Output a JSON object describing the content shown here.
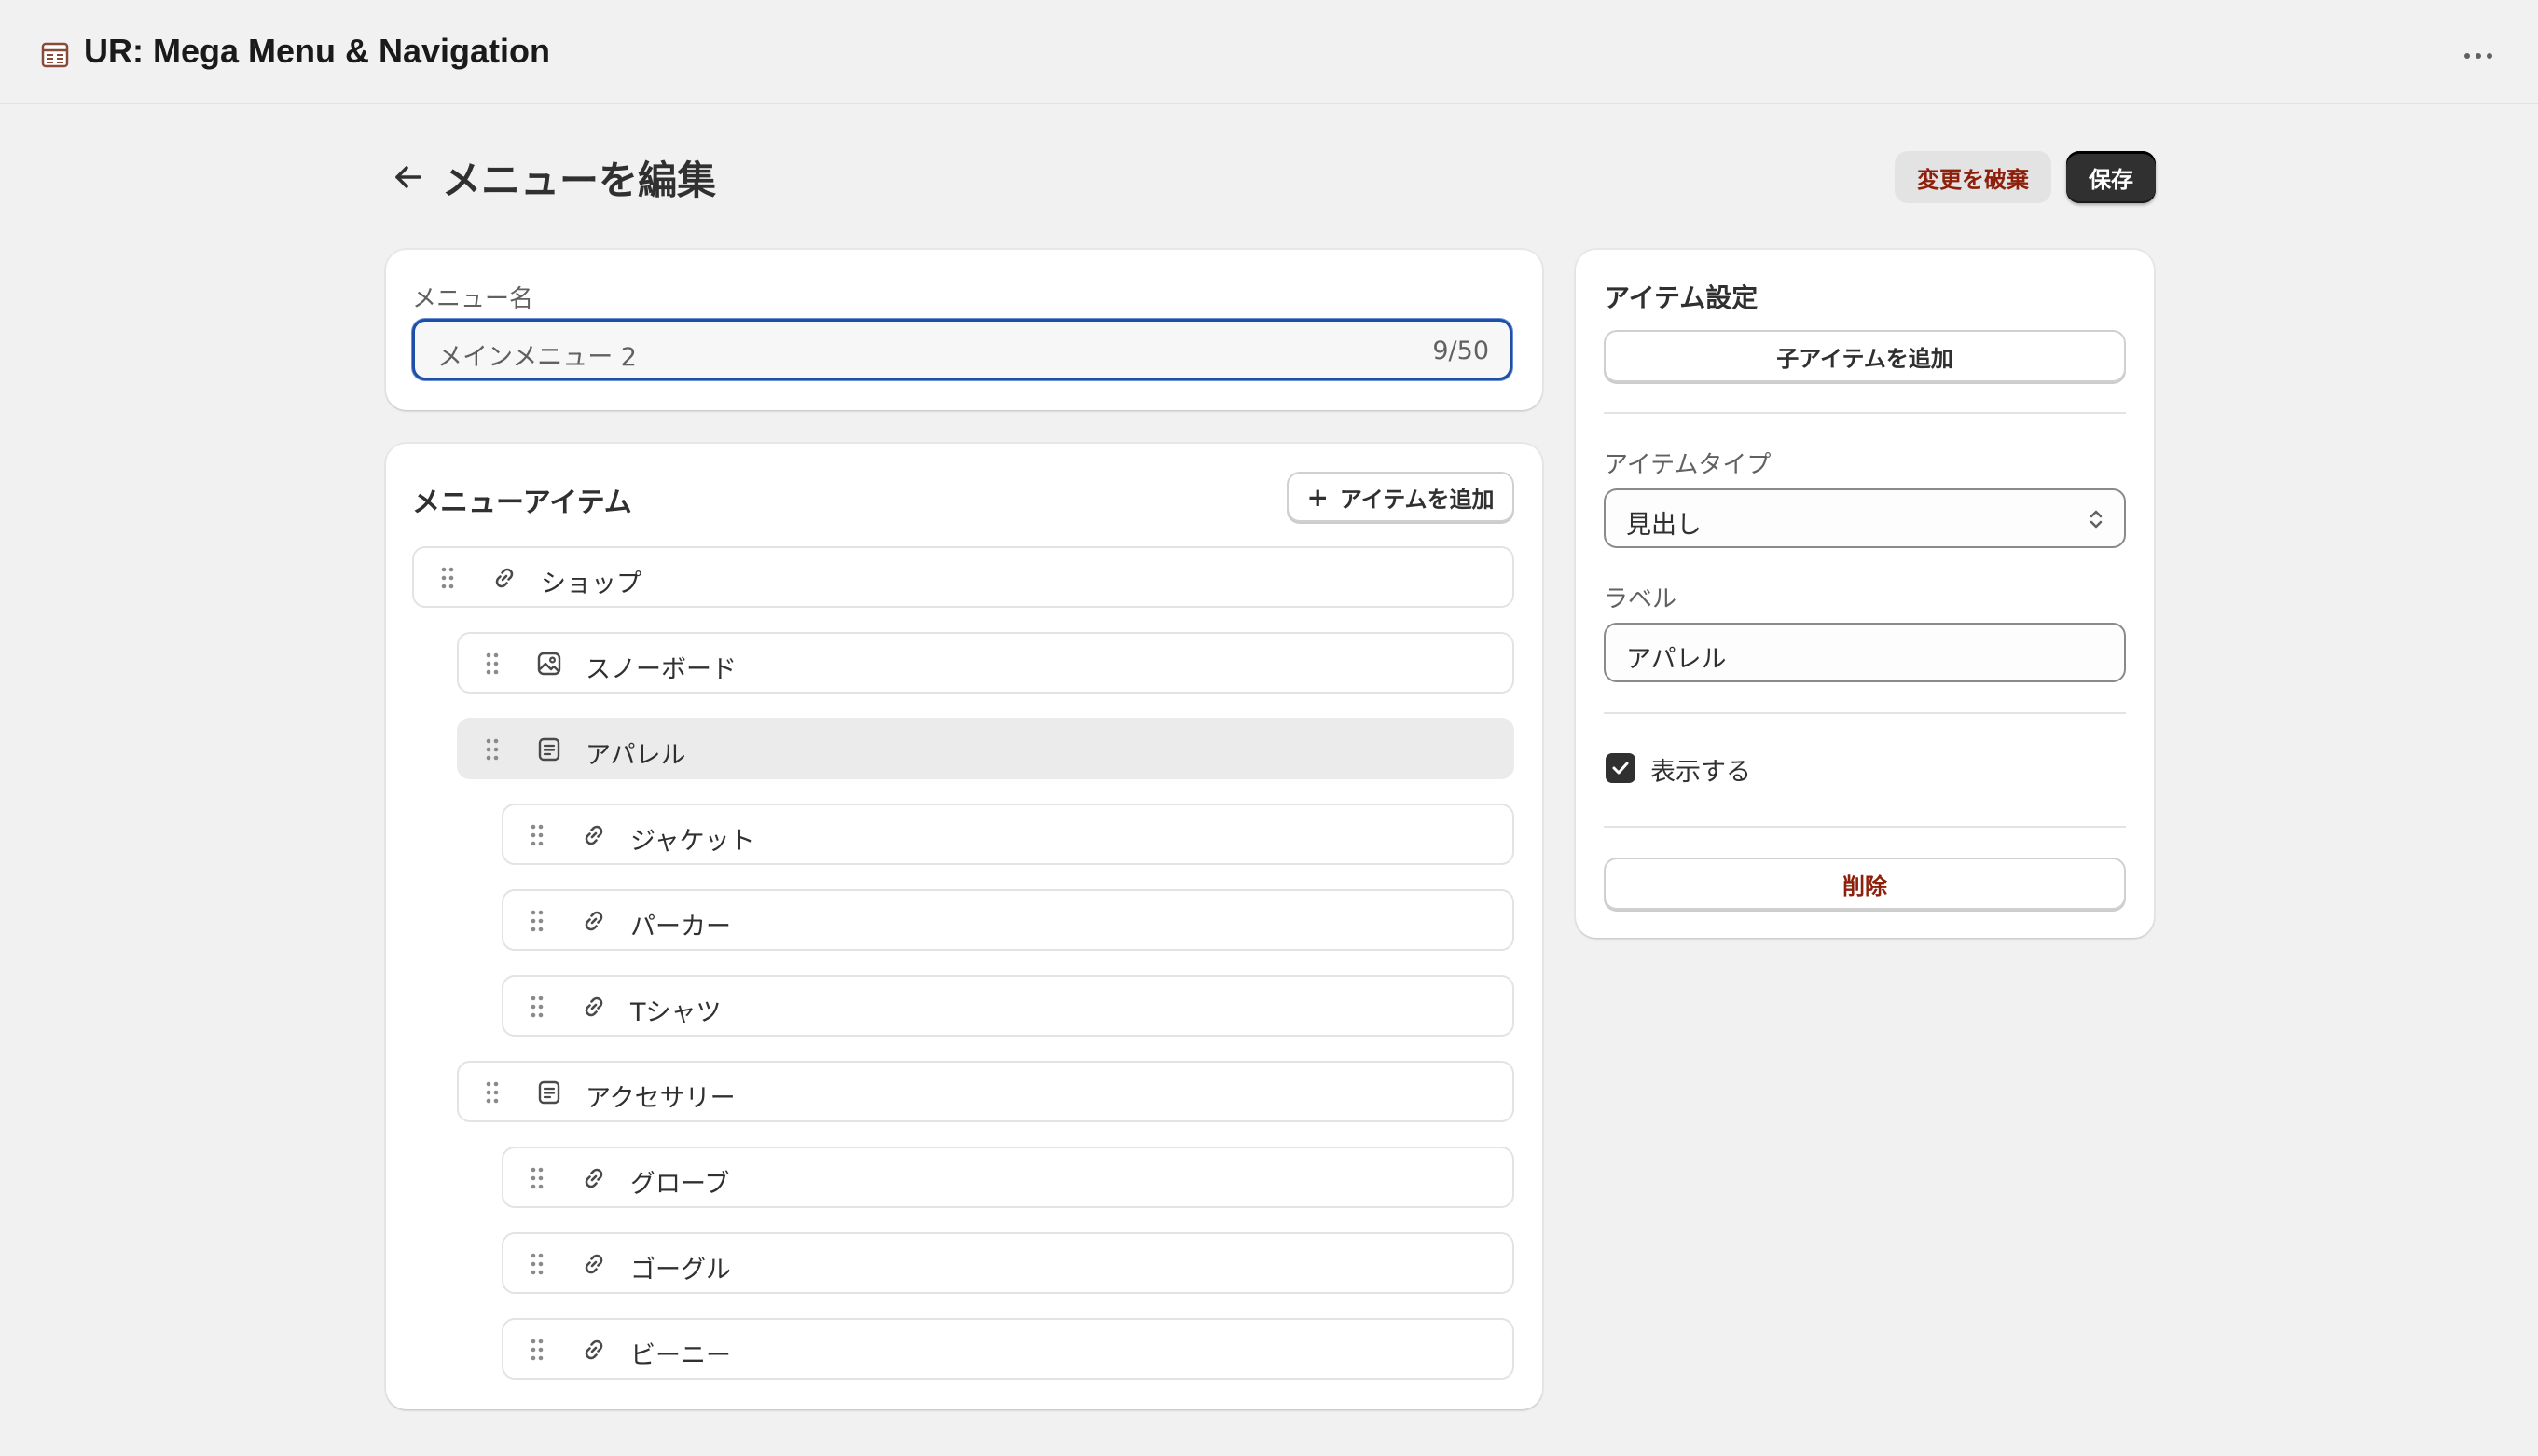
{
  "app": {
    "title": "UR: Mega Menu & Navigation",
    "icon": "table-icon",
    "more_icon": "ellipsis-icon"
  },
  "header": {
    "back_icon": "arrow-left-icon",
    "title": "メニューを編集",
    "discard_label": "変更を破棄",
    "save_label": "保存"
  },
  "menu_name": {
    "label": "メニュー名",
    "value": "メインメニュー 2",
    "counter": "9/50"
  },
  "menu_items": {
    "title": "メニューアイテム",
    "add_label": "アイテムを追加",
    "add_icon": "+",
    "items": [
      {
        "label": "ショップ",
        "icon": "link-icon",
        "level": 0,
        "selected": false
      },
      {
        "label": "スノーボード",
        "icon": "image-icon",
        "level": 1,
        "selected": false
      },
      {
        "label": "アパレル",
        "icon": "heading-icon",
        "level": 1,
        "selected": true
      },
      {
        "label": "ジャケット",
        "icon": "link-icon",
        "level": 2,
        "selected": false
      },
      {
        "label": "パーカー",
        "icon": "link-icon",
        "level": 2,
        "selected": false
      },
      {
        "label": "Tシャツ",
        "icon": "link-icon",
        "level": 2,
        "selected": false
      },
      {
        "label": "アクセサリー",
        "icon": "heading-icon",
        "level": 1,
        "selected": false
      },
      {
        "label": "グローブ",
        "icon": "link-icon",
        "level": 2,
        "selected": false
      },
      {
        "label": "ゴーグル",
        "icon": "link-icon",
        "level": 2,
        "selected": false
      },
      {
        "label": "ビーニー",
        "icon": "link-icon",
        "level": 2,
        "selected": false
      }
    ]
  },
  "item_settings": {
    "title": "アイテム設定",
    "add_child_label": "子アイテムを追加",
    "type_label": "アイテムタイプ",
    "type_value": "見出し",
    "label_label": "ラベル",
    "label_value": "アパレル",
    "visible_label": "表示する",
    "visible_checked": true,
    "delete_label": "削除"
  },
  "colors": {
    "background": "#f1f1f1",
    "card": "#ffffff",
    "primary_button": "#303030",
    "critical_text": "#8e1f0b",
    "focus_ring": "#1d4fa6",
    "selected_row": "#ebebeb"
  }
}
